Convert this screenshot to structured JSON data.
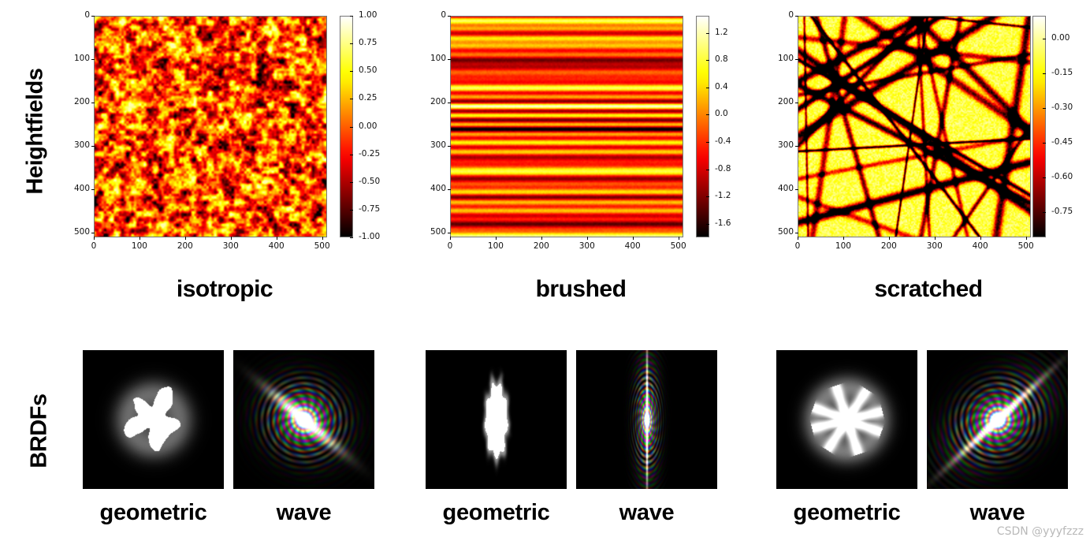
{
  "figure": {
    "row_labels": [
      {
        "id": "heightfields",
        "text": "Heightfields"
      },
      {
        "id": "brdfs",
        "text": "BRDFs"
      }
    ],
    "column_captions": [
      "isotropic",
      "brushed",
      "scratched"
    ],
    "watermark": "CSDN @yyyfzzz"
  },
  "chart_data": [
    {
      "type": "heatmap",
      "title": "isotropic",
      "row": "Heightfields",
      "colormap": "hot",
      "xlabel": "",
      "ylabel": "",
      "xlim": [
        0,
        511
      ],
      "ylim": [
        511,
        0
      ],
      "xticks": [
        "0",
        "100",
        "200",
        "300",
        "400",
        "500"
      ],
      "yticks": [
        "0",
        "100",
        "200",
        "300",
        "400",
        "500"
      ],
      "grid": false,
      "colorbar": {
        "vmin": -1.0,
        "vmax": 1.0,
        "ticks": [
          "1.00",
          "0.75",
          "0.50",
          "0.25",
          "0.00",
          "-0.25",
          "-0.50",
          "-0.75",
          "-1.00"
        ],
        "tick_values": [
          1.0,
          0.75,
          0.5,
          0.25,
          0.0,
          -0.25,
          -0.5,
          -0.75,
          -1.0
        ],
        "position": "right"
      },
      "pattern": "isotropic-gaussian-noise"
    },
    {
      "type": "heatmap",
      "title": "brushed",
      "row": "Heightfields",
      "colormap": "hot",
      "xlabel": "",
      "ylabel": "",
      "xlim": [
        0,
        511
      ],
      "ylim": [
        511,
        0
      ],
      "xticks": [
        "0",
        "100",
        "200",
        "300",
        "400",
        "500"
      ],
      "yticks": [
        "0",
        "100",
        "200",
        "300",
        "400",
        "500"
      ],
      "grid": false,
      "colorbar": {
        "vmin": -1.8,
        "vmax": 1.45,
        "ticks": [
          "1.2",
          "0.8",
          "0.4",
          "0.0",
          "-0.4",
          "-0.8",
          "-1.2",
          "-1.6"
        ],
        "tick_values": [
          1.2,
          0.8,
          0.4,
          0.0,
          -0.4,
          -0.8,
          -1.2,
          -1.6
        ],
        "position": "right"
      },
      "pattern": "horizontal-stripes"
    },
    {
      "type": "heatmap",
      "title": "scratched",
      "row": "Heightfields",
      "colormap": "hot",
      "xlabel": "",
      "ylabel": "",
      "xlim": [
        0,
        511
      ],
      "ylim": [
        511,
        0
      ],
      "xticks": [
        "0",
        "100",
        "200",
        "300",
        "400",
        "500"
      ],
      "yticks": [
        "0",
        "100",
        "200",
        "300",
        "400",
        "500"
      ],
      "grid": false,
      "colorbar": {
        "vmin": -0.86,
        "vmax": 0.1,
        "ticks": [
          "0.00",
          "-0.15",
          "-0.30",
          "-0.45",
          "-0.60",
          "-0.75"
        ],
        "tick_values": [
          0.0,
          -0.15,
          -0.3,
          -0.45,
          -0.6,
          -0.75
        ],
        "position": "right"
      },
      "pattern": "random-scratch-lines"
    }
  ],
  "brdf_row": {
    "label": "BRDFs",
    "groups": [
      {
        "surface": "isotropic",
        "panels": [
          {
            "caption": "geometric",
            "render": "geometric-isotropic"
          },
          {
            "caption": "wave",
            "render": "wave-isotropic"
          }
        ]
      },
      {
        "surface": "brushed",
        "panels": [
          {
            "caption": "geometric",
            "render": "geometric-brushed"
          },
          {
            "caption": "wave",
            "render": "wave-brushed"
          }
        ]
      },
      {
        "surface": "scratched",
        "panels": [
          {
            "caption": "geometric",
            "render": "geometric-scratched"
          },
          {
            "caption": "wave",
            "render": "wave-scratched"
          }
        ]
      }
    ]
  }
}
